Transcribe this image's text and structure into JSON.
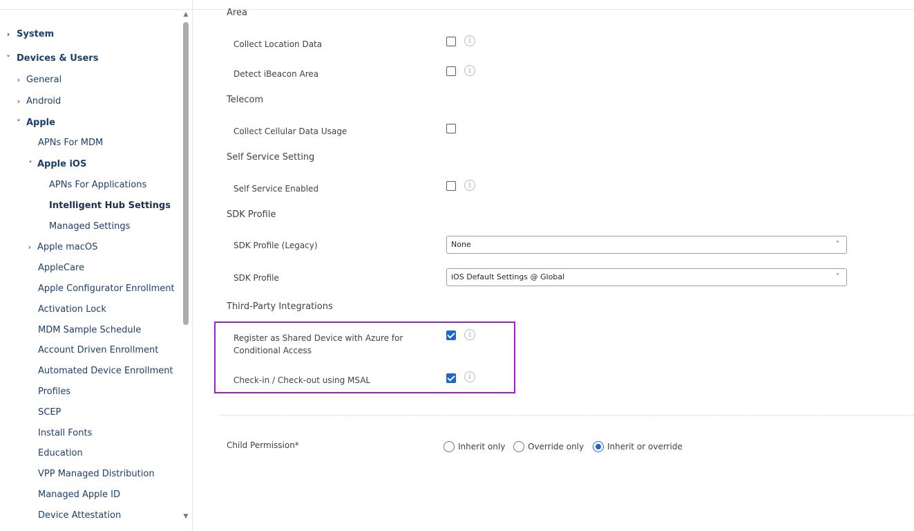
{
  "sidebar": {
    "items": [
      {
        "label": "System",
        "chevron": "›"
      },
      {
        "label": "Devices & Users",
        "chevron": "˅"
      },
      {
        "label": "General",
        "chevron": "›"
      },
      {
        "label": "Android",
        "chevron": "›"
      },
      {
        "label": "Apple",
        "chevron": "˅"
      },
      {
        "label": "APNs For MDM"
      },
      {
        "label": "Apple iOS",
        "chevron": "˅"
      },
      {
        "label": "APNs For Applications"
      },
      {
        "label": "Intelligent Hub Settings"
      },
      {
        "label": "Managed Settings"
      },
      {
        "label": "Apple macOS",
        "chevron": "›"
      },
      {
        "label": "AppleCare"
      },
      {
        "label": "Apple Configurator Enrollment"
      },
      {
        "label": "Activation Lock"
      },
      {
        "label": "MDM Sample Schedule"
      },
      {
        "label": "Account Driven Enrollment"
      },
      {
        "label": "Automated Device Enrollment"
      },
      {
        "label": "Profiles"
      },
      {
        "label": "SCEP"
      },
      {
        "label": "Install Fonts"
      },
      {
        "label": "Education"
      },
      {
        "label": "VPP Managed Distribution"
      },
      {
        "label": "Managed Apple ID"
      },
      {
        "label": "Device Attestation"
      }
    ],
    "scroll_up_glyph": "▲",
    "scroll_down_glyph": "▼"
  },
  "main": {
    "sections": {
      "area": "Area",
      "telecom": "Telecom",
      "self_service": "Self Service Setting",
      "sdk": "SDK Profile",
      "third_party": "Third-Party Integrations"
    },
    "rows": {
      "collect_location": {
        "label": "Collect Location Data",
        "checked": false
      },
      "detect_ibeacon": {
        "label": "Detect iBeacon Area",
        "checked": false
      },
      "collect_cellular": {
        "label": "Collect Cellular Data Usage",
        "checked": false
      },
      "self_service_enabled": {
        "label": "Self Service Enabled",
        "checked": false
      },
      "register_shared_line1": "Register as Shared Device with Azure for",
      "register_shared_line2": "Conditional Access",
      "register_shared_checked": true,
      "checkin_msal": {
        "label": "Check-in / Check-out using MSAL",
        "checked": true
      }
    },
    "sdk_legacy": {
      "label": "SDK Profile (Legacy)",
      "value": "None"
    },
    "sdk_profile": {
      "label": "SDK Profile",
      "value": "iOS Default Settings @ Global"
    },
    "dropdown_arrow": "˅",
    "info_glyph": "i",
    "child_permission": {
      "label": "Child Permission*",
      "options": [
        "Inherit only",
        "Override only",
        "Inherit or override"
      ],
      "selected": "Inherit or override"
    }
  },
  "colors": {
    "accent": "#1f66c9",
    "highlight_border": "#a020d0",
    "nav_text": "#1c3f6e"
  }
}
